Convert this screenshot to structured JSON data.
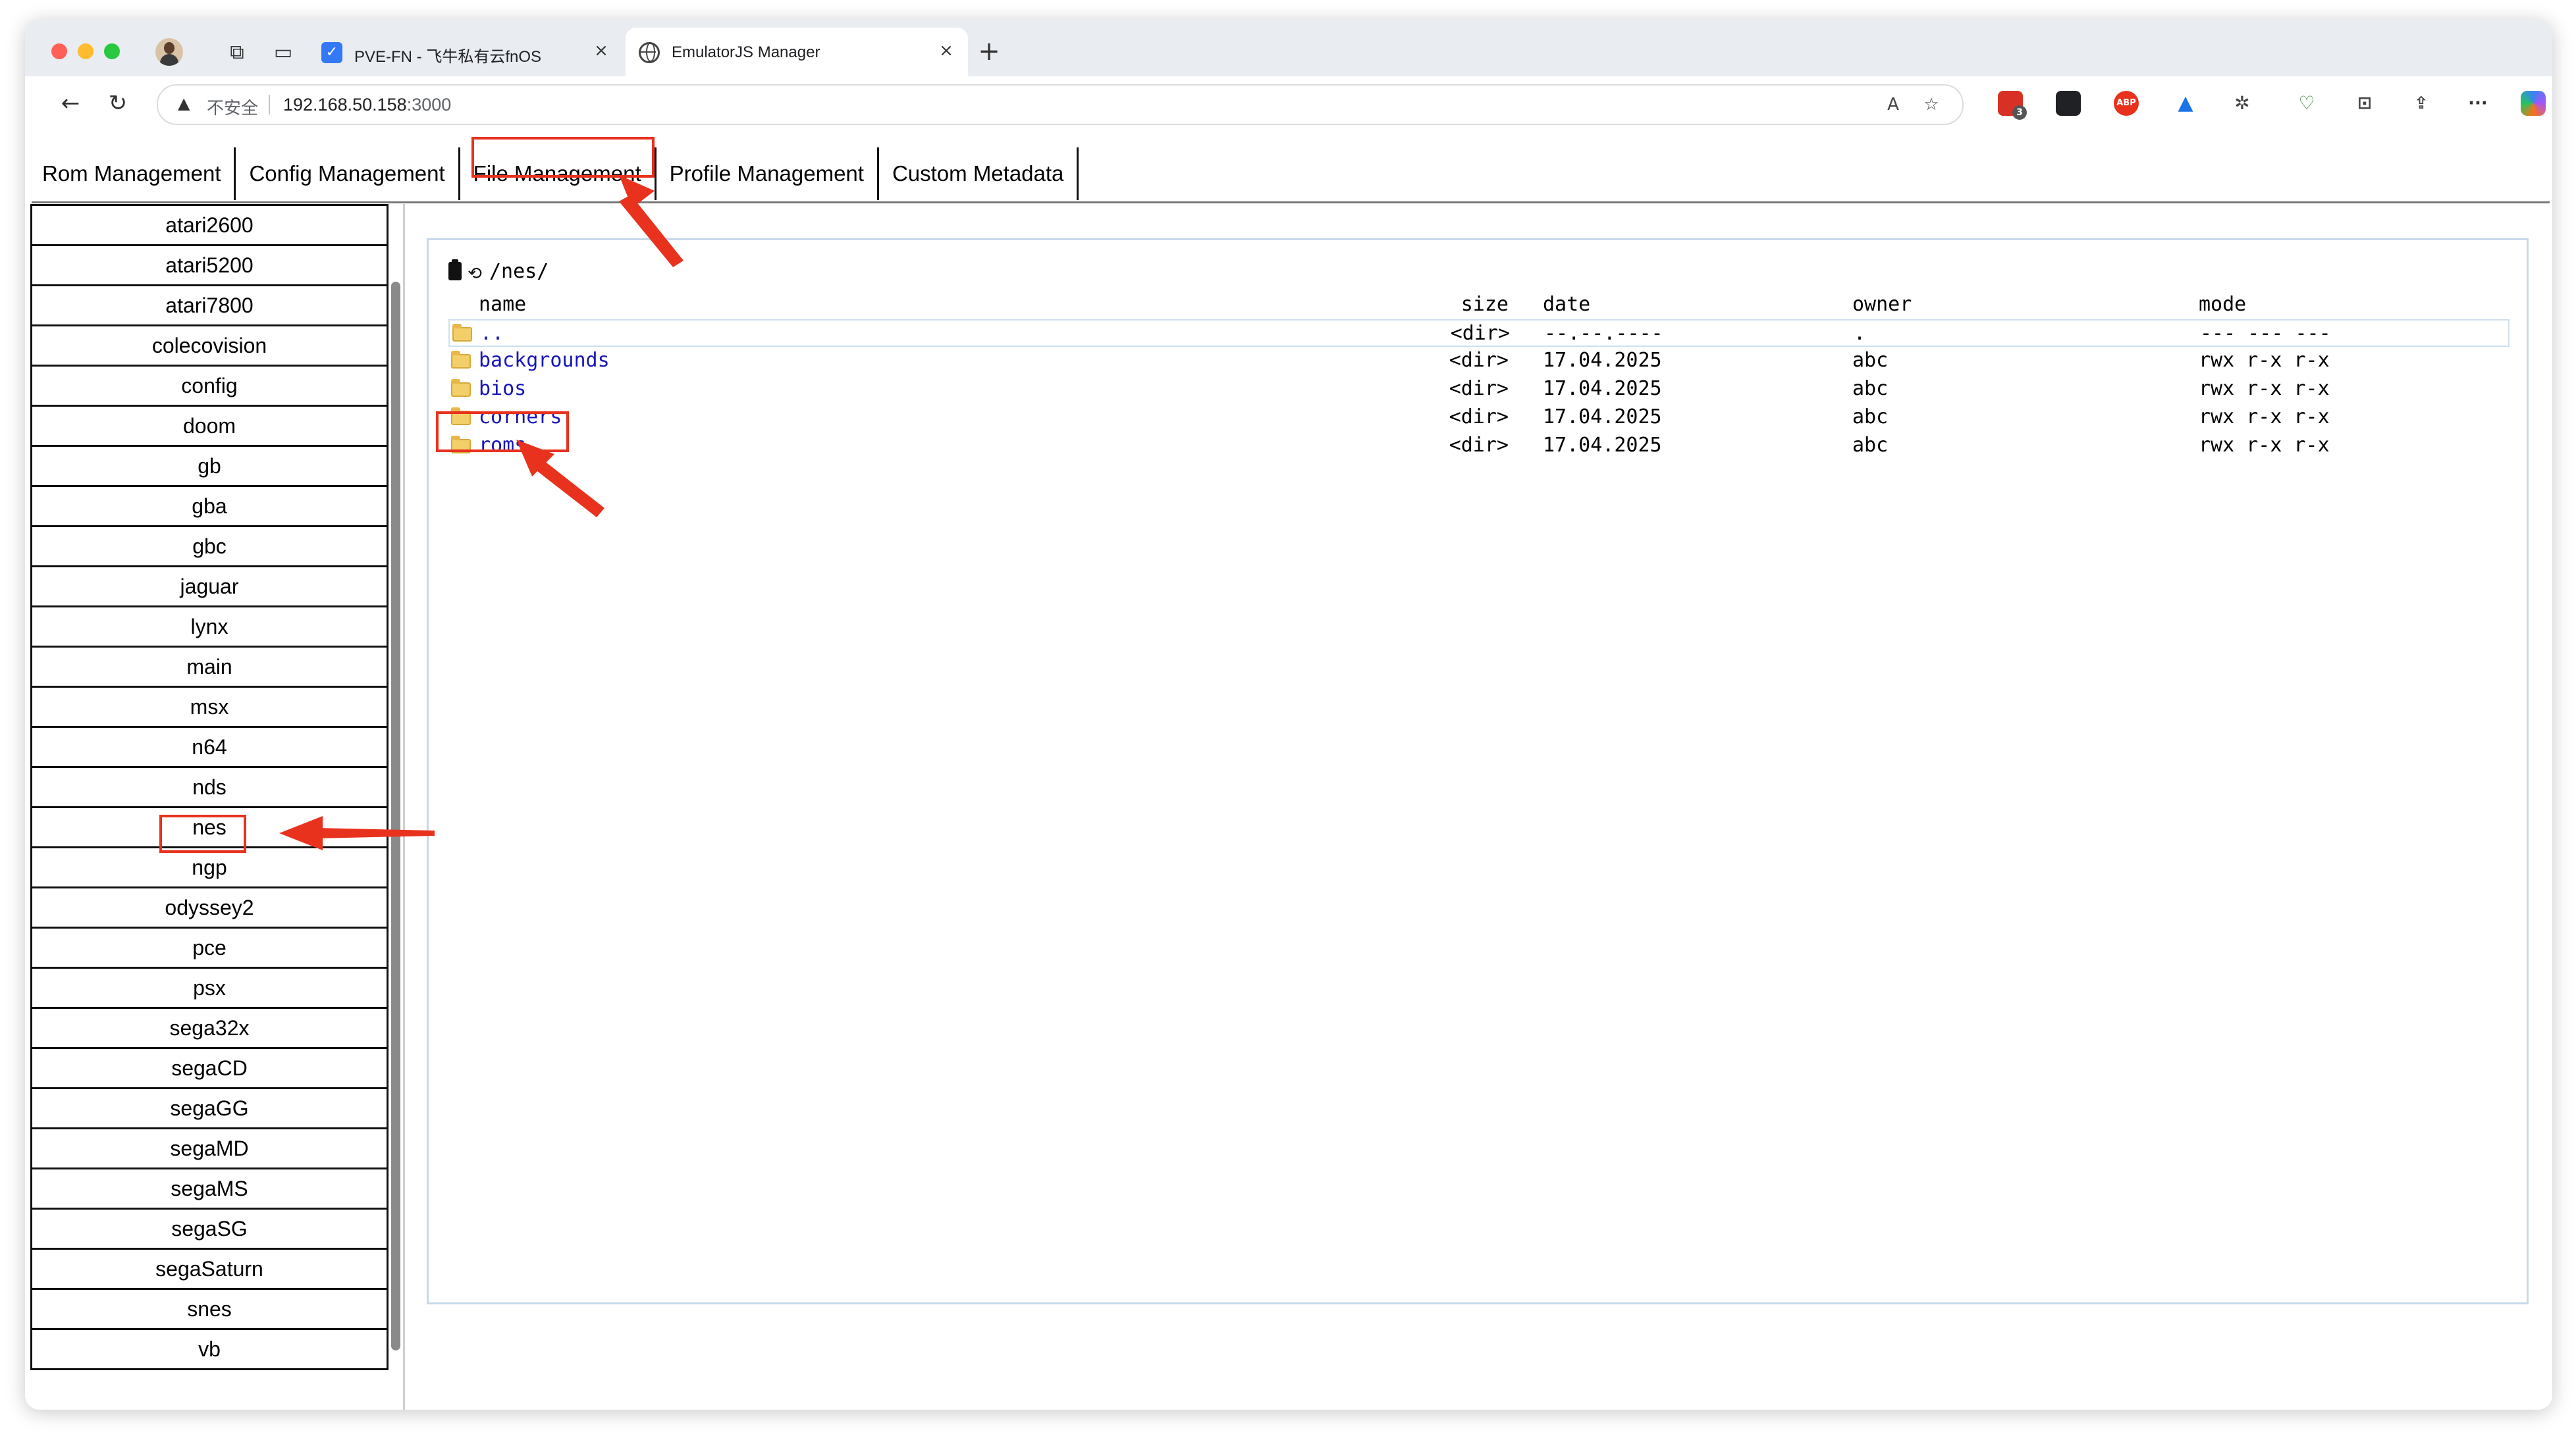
{
  "browser": {
    "tabs": [
      {
        "title": "PVE-FN - 飞牛私有云fnOS",
        "favicon": "fnos-icon",
        "active": false,
        "close": "×"
      },
      {
        "title": "EmulatorJS Manager",
        "favicon": "globe-icon",
        "active": true,
        "close": "×"
      }
    ],
    "new_tab": "+",
    "address_bar": {
      "security_label": "不安全",
      "host": "192.168.50.158",
      "port": ":3000"
    },
    "extensions": [
      {
        "name": "extension-red-icon",
        "badge": "3",
        "color": "#d93025"
      },
      {
        "name": "extension-notes-icon",
        "color": "#202124"
      },
      {
        "name": "adblock-icon",
        "label": "ABP",
        "color": "#e8321e"
      },
      {
        "name": "drive-icon",
        "color": "#1a73e8"
      },
      {
        "name": "puzzle-icon",
        "color": "#444444"
      }
    ],
    "menu": "···"
  },
  "app": {
    "nav_tabs": [
      {
        "label": "Rom Management"
      },
      {
        "label": "Config Management"
      },
      {
        "label": "File Management"
      },
      {
        "label": "Profile Management"
      },
      {
        "label": "Custom Metadata"
      }
    ],
    "sidebar": [
      "atari2600",
      "atari5200",
      "atari7800",
      "colecovision",
      "config",
      "doom",
      "gb",
      "gba",
      "gbc",
      "jaguar",
      "lynx",
      "main",
      "msx",
      "n64",
      "nds",
      "nes",
      "ngp",
      "odyssey2",
      "pce",
      "psx",
      "sega32x",
      "segaCD",
      "segaGG",
      "segaMD",
      "segaMS",
      "segaSG",
      "segaSaturn",
      "snes",
      "vb"
    ],
    "file_manager": {
      "path": "/nes/",
      "columns": {
        "name": "name",
        "size": "size",
        "date": "date",
        "owner": "owner",
        "mode": "mode"
      },
      "rows": [
        {
          "name": "..",
          "size": "<dir>",
          "date": "--.--.----",
          "owner": ".",
          "mode": "--- --- ---"
        },
        {
          "name": "backgrounds",
          "size": "<dir>",
          "date": "17.04.2025",
          "owner": "abc",
          "mode": "rwx r-x r-x"
        },
        {
          "name": "bios",
          "size": "<dir>",
          "date": "17.04.2025",
          "owner": "abc",
          "mode": "rwx r-x r-x"
        },
        {
          "name": "corners",
          "size": "<dir>",
          "date": "17.04.2025",
          "owner": "abc",
          "mode": "rwx r-x r-x"
        },
        {
          "name": "roms",
          "size": "<dir>",
          "date": "17.04.2025",
          "owner": "abc",
          "mode": "rwx r-x r-x"
        }
      ]
    }
  },
  "colors": {
    "annotation": "#e8321e",
    "link": "#1616b8",
    "panel_border": "#c7d9ea"
  }
}
